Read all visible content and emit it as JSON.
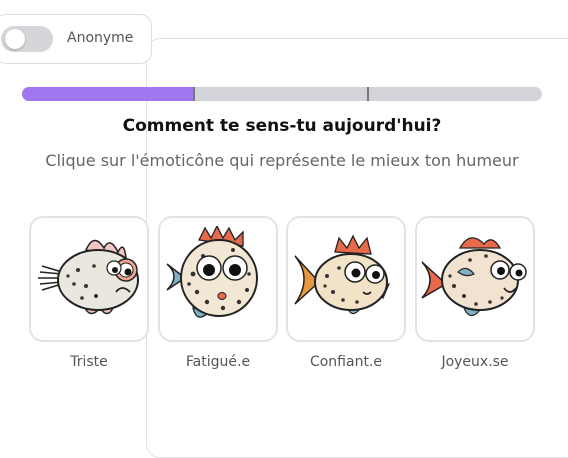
{
  "anonymous_toggle": {
    "label": "Anonyme",
    "on": false
  },
  "progress": {
    "fraction": 0.33
  },
  "question": {
    "title": "Comment te sens-tu aujourd'hui?",
    "hint": "Clique sur l'émoticône qui représente le mieux ton humeur"
  },
  "moods": [
    {
      "label": "Triste",
      "icon": "sad-fish-icon"
    },
    {
      "label": "Fatigué.e",
      "icon": "tired-fish-icon"
    },
    {
      "label": "Confiant.e",
      "icon": "confident-fish-icon"
    },
    {
      "label": "Joyeux.se",
      "icon": "happy-fish-icon"
    }
  ],
  "colors": {
    "accent": "#a077ef",
    "track": "#d3d4d9",
    "fin": "#e86a4a",
    "tail_blue": "#7fb3c4"
  }
}
